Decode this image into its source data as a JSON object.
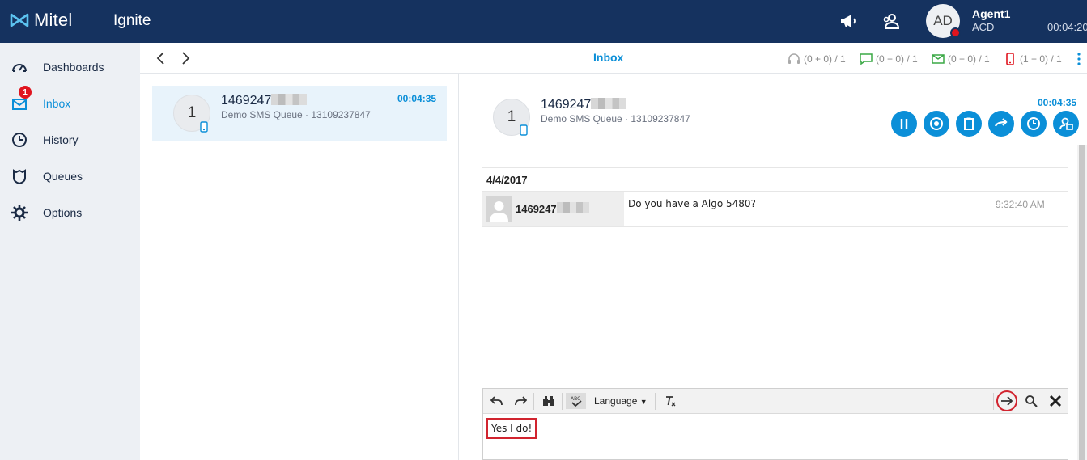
{
  "header": {
    "brand": "Mitel",
    "product": "Ignite",
    "avatar_initials": "AD",
    "agent_name": "Agent1",
    "agent_state": "ACD",
    "timer": "00:04:20"
  },
  "sidebar": {
    "items": [
      {
        "label": "Dashboards",
        "icon": "dashboard-icon"
      },
      {
        "label": "Inbox",
        "icon": "inbox-icon",
        "badge": "1",
        "active": true
      },
      {
        "label": "History",
        "icon": "clock-icon"
      },
      {
        "label": "Queues",
        "icon": "queue-shield-icon"
      },
      {
        "label": "Options",
        "icon": "gear-icon"
      }
    ]
  },
  "topbar": {
    "title": "Inbox",
    "stats": {
      "voice": "(0 + 0) / 1",
      "chat": "(0 + 0) / 1",
      "email": "(0 + 0) / 1",
      "sms": "(1 + 0) / 1"
    }
  },
  "conversation": {
    "avatar_count": "1",
    "number_prefix": "1469247",
    "queue": "Demo SMS Queue · 13109237847",
    "timer": "00:04:35"
  },
  "detail": {
    "avatar_count": "1",
    "number_prefix": "1469247",
    "queue": "Demo SMS Queue · 13109237847",
    "timer": "00:04:35",
    "actions": [
      "pause",
      "record",
      "clipboard",
      "transfer",
      "schedule",
      "conference"
    ]
  },
  "transcript": {
    "date": "4/4/2017",
    "messages": [
      {
        "sender_prefix": "1469247",
        "text": "Do you have a Algo 5480?",
        "time": "9:32:40 AM"
      }
    ]
  },
  "editor": {
    "language_label": "Language",
    "reply": "Yes I do!"
  },
  "colors": {
    "header_bg": "#15325f",
    "accent": "#0b8fd8",
    "badge": "#e0141e"
  }
}
